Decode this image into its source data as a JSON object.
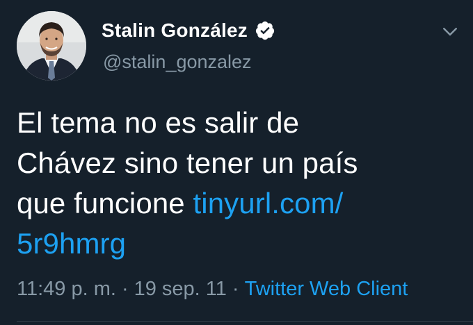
{
  "tweet": {
    "display_name": "Stalin González",
    "handle": "@stalin_gonzalez",
    "verified": true,
    "text_line_1": "El tema no es salir de",
    "text_line_2": "Chávez sino tener un país",
    "text_line_3_prefix": "que funcione ",
    "link_part_1": "tinyurl.com/",
    "link_part_2": "5r9hmrg",
    "time": "11:49 p. m.",
    "separator": "·",
    "date": "19 sep. 11",
    "source": "Twitter Web Client"
  },
  "icons": {
    "verified": "verified-badge-icon",
    "menu": "chevron-down-icon"
  },
  "colors": {
    "background": "#15202b",
    "link": "#1da1f2",
    "secondary_text": "#8899a6",
    "primary_text": "#ffffff"
  }
}
